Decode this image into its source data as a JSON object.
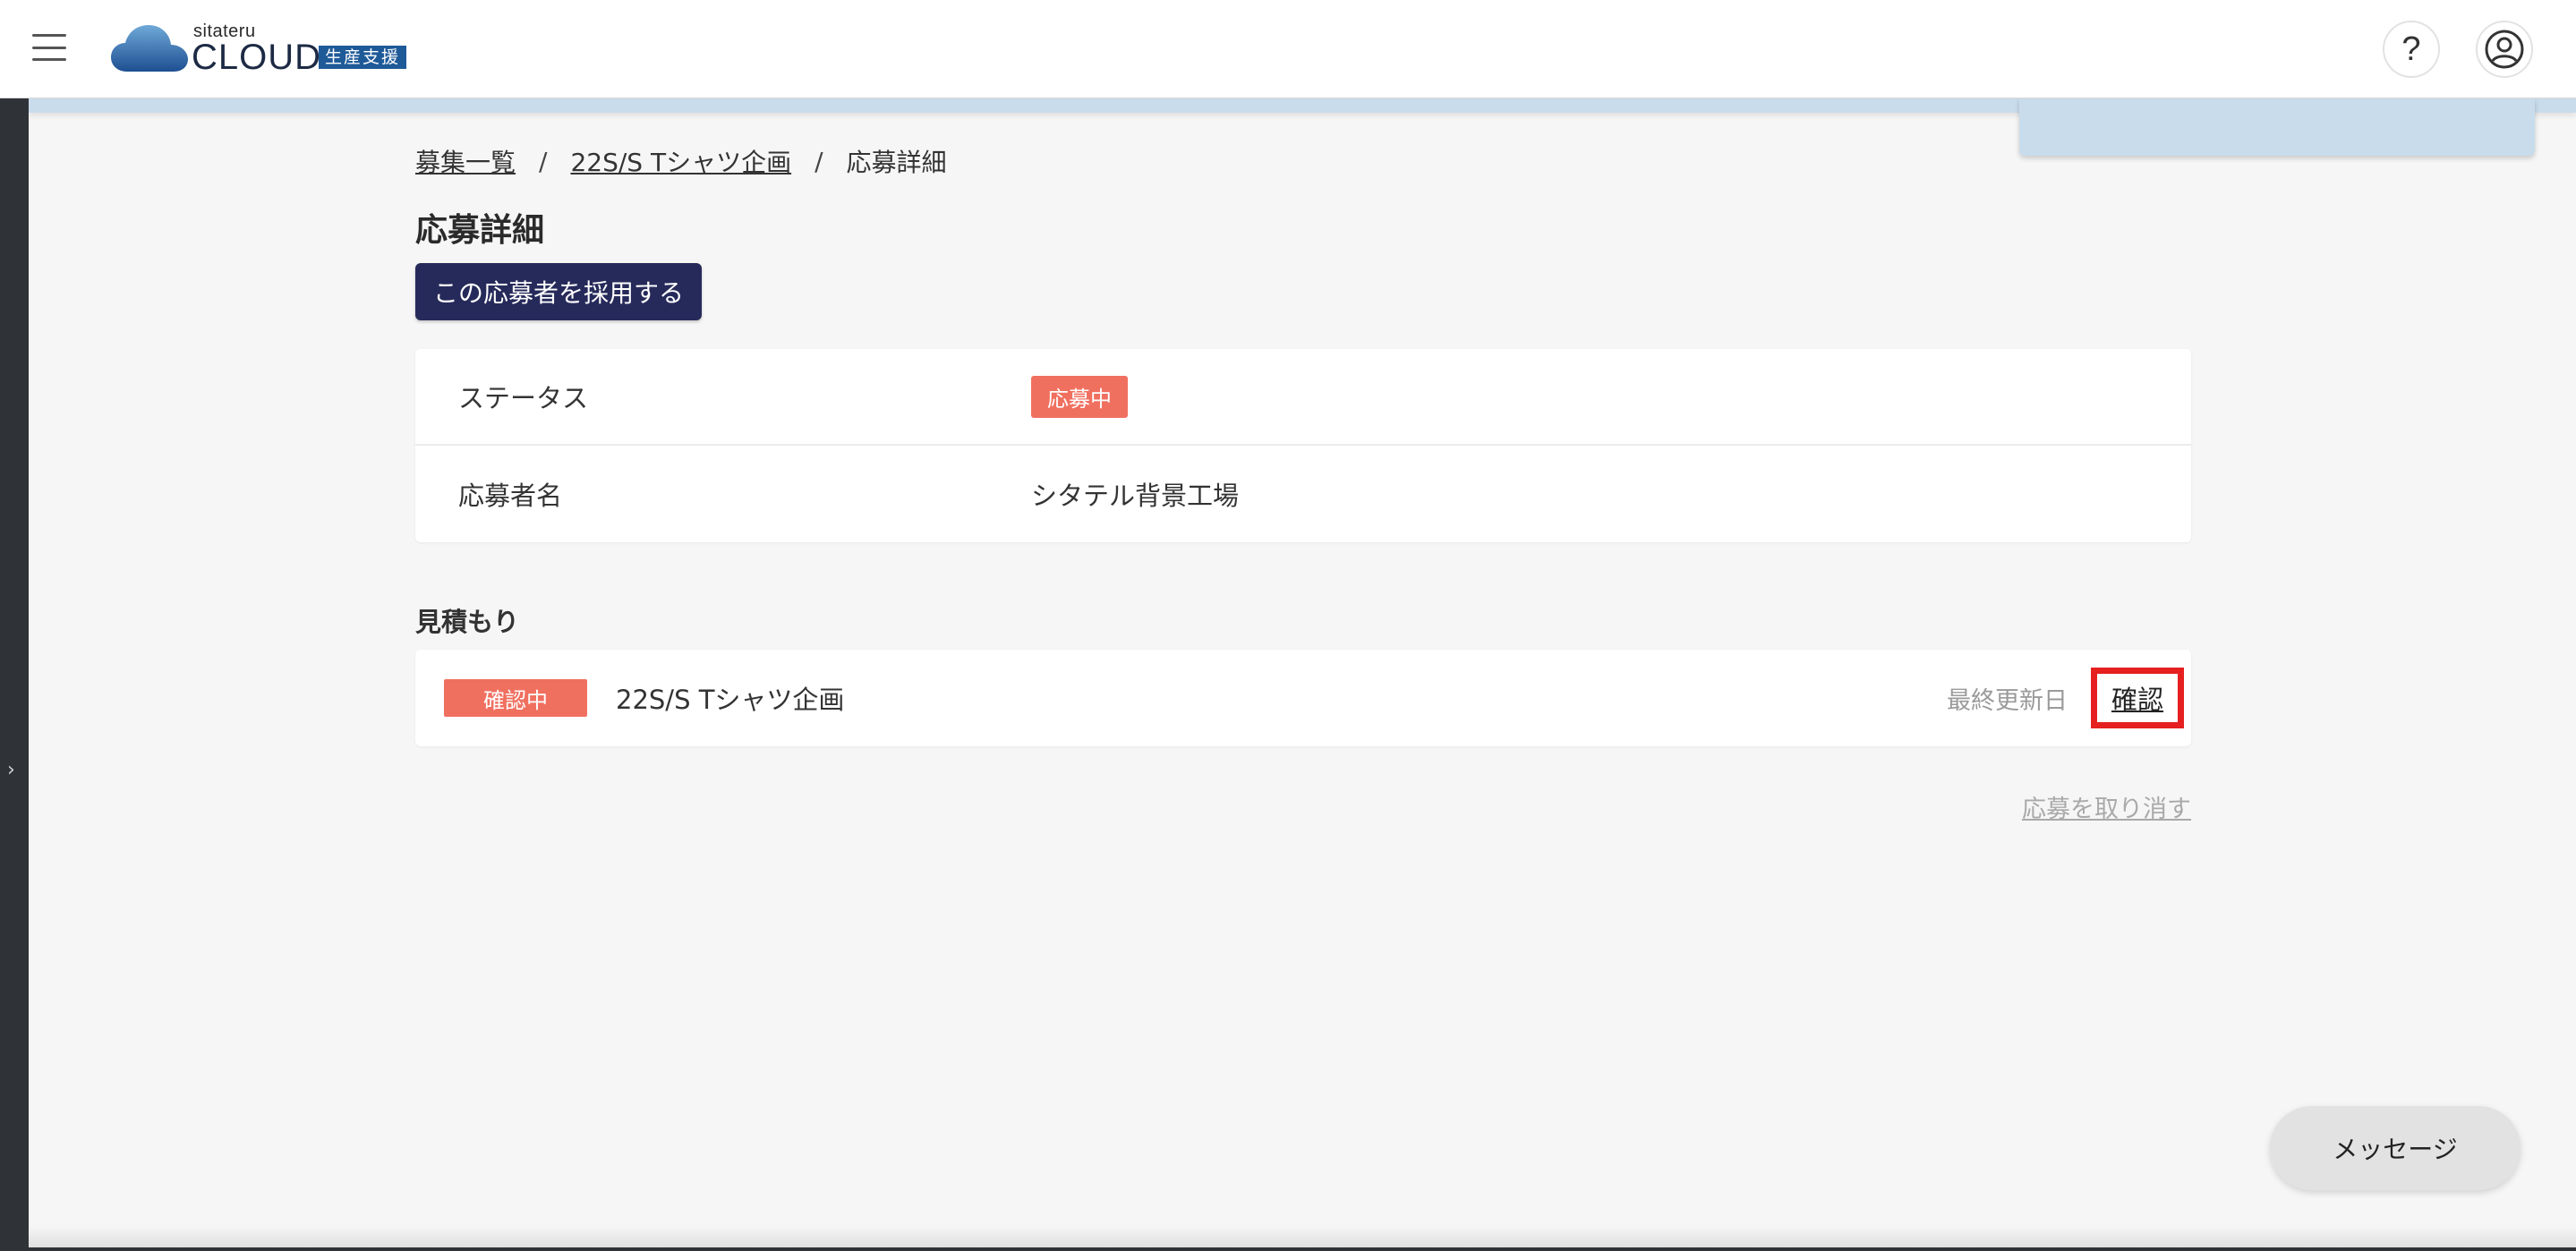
{
  "header": {
    "logo_small": "sitateru",
    "logo_main": "CLOUD",
    "logo_badge": "生産支援",
    "help_label": "?"
  },
  "sidebar": {
    "toggle_glyph": "›"
  },
  "breadcrumb": {
    "items": [
      "募集一覧",
      "22S/S Tシャツ企画",
      "応募詳細"
    ],
    "separator": "/"
  },
  "page": {
    "title": "応募詳細",
    "adopt_button": "この応募者を採用する"
  },
  "info": {
    "rows": [
      {
        "label": "ステータス",
        "badge": "応募中"
      },
      {
        "label": "応募者名",
        "value": "シタテル背景工場"
      }
    ]
  },
  "estimate": {
    "section_label": "見積もり",
    "status_badge": "確認中",
    "title": "22S/S Tシャツ企画",
    "date_label": "最終更新日",
    "confirm_link": "確認"
  },
  "actions": {
    "withdraw_link": "応募を取り消す",
    "message_button": "メッセージ"
  },
  "colors": {
    "primary": "#262a5a",
    "status_badge": "#f07060",
    "highlight_box": "#e62020",
    "logo_badge": "#1f5a98"
  },
  "icons": {
    "menu": "hamburger-menu-icon",
    "help": "question-mark-icon",
    "account": "user-circle-icon",
    "sidebar_toggle": "chevron-right-icon",
    "logo": "cloud-logo-icon"
  }
}
